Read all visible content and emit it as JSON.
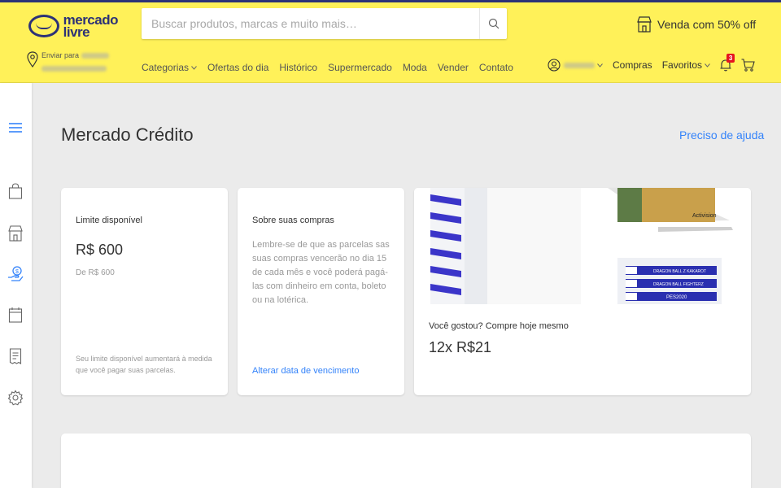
{
  "header": {
    "logo_line1": "mercado",
    "logo_line2": "livre",
    "search_placeholder": "Buscar produtos, marcas e muito mais…",
    "promo_text": "Venda com 50% off",
    "location_label": "Enviar para",
    "nav": [
      "Categorias",
      "Ofertas do dia",
      "Histórico",
      "Supermercado",
      "Moda",
      "Vender",
      "Contato"
    ],
    "user_links": {
      "purchases": "Compras",
      "favorites": "Favoritos"
    },
    "notifications_count": "3",
    "brand_color": "#fff159"
  },
  "sidebar": {
    "icons": [
      "menu-icon",
      "shopping-bag-icon",
      "store-icon",
      "credit-hand-icon",
      "calendar-icon",
      "receipt-icon",
      "settings-icon"
    ],
    "active_color": "#3483fa"
  },
  "page": {
    "title": "Mercado Crédito",
    "help_link": "Preciso de ajuda"
  },
  "cards": {
    "limit": {
      "title": "Limite disponível",
      "amount": "R$ 600",
      "sub": "De R$ 600",
      "footnote": "Seu limite disponível aumentará à medida que você pagar suas parcelas."
    },
    "purchases": {
      "title": "Sobre suas compras",
      "body": "Lembre-se de que as parcelas sas suas compras vencerão no dia 15 de cada mês e você poderá pagá-las com dinheiro em conta, boleto ou na lotérica.",
      "link": "Alterar data de vencimento"
    },
    "promo": {
      "title": "Você gostou? Compre hoje mesmo",
      "price": "12x R$21",
      "img_texts": [
        "DRAGON BALL Z KAKAROT",
        "DRAGON BALL FIGHTERZ",
        "PES2020",
        "Activision"
      ]
    }
  }
}
